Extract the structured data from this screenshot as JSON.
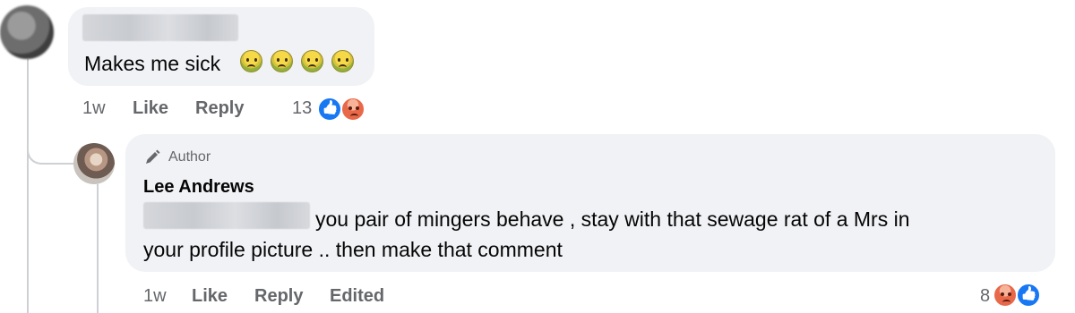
{
  "comment": {
    "text": "Makes me sick",
    "emoji_icons": [
      "nauseated-face-icon",
      "nauseated-face-icon",
      "nauseated-face-icon",
      "nauseated-face-icon"
    ],
    "meta": {
      "time": "1w",
      "like": "Like",
      "reply": "Reply"
    },
    "reactions": {
      "count": "13",
      "icons": [
        "like-icon",
        "angry-icon"
      ]
    }
  },
  "reply": {
    "badge": "Author",
    "author": "Lee Andrews",
    "text_line1": "you pair of mingers behave , stay with that sewage rat of a Mrs in",
    "text_line2": "your profile picture .. then make that comment",
    "meta": {
      "time": "1w",
      "like": "Like",
      "reply": "Reply",
      "edited": "Edited"
    },
    "reactions": {
      "count": "8",
      "icons": [
        "angry-icon",
        "like-icon"
      ]
    }
  },
  "colors": {
    "bubble": "#f0f2f5",
    "meta_text": "#65676b",
    "like_blue": "#1877f2",
    "angry_orange": "#e8694a",
    "thread_line": "#ced0d4"
  }
}
